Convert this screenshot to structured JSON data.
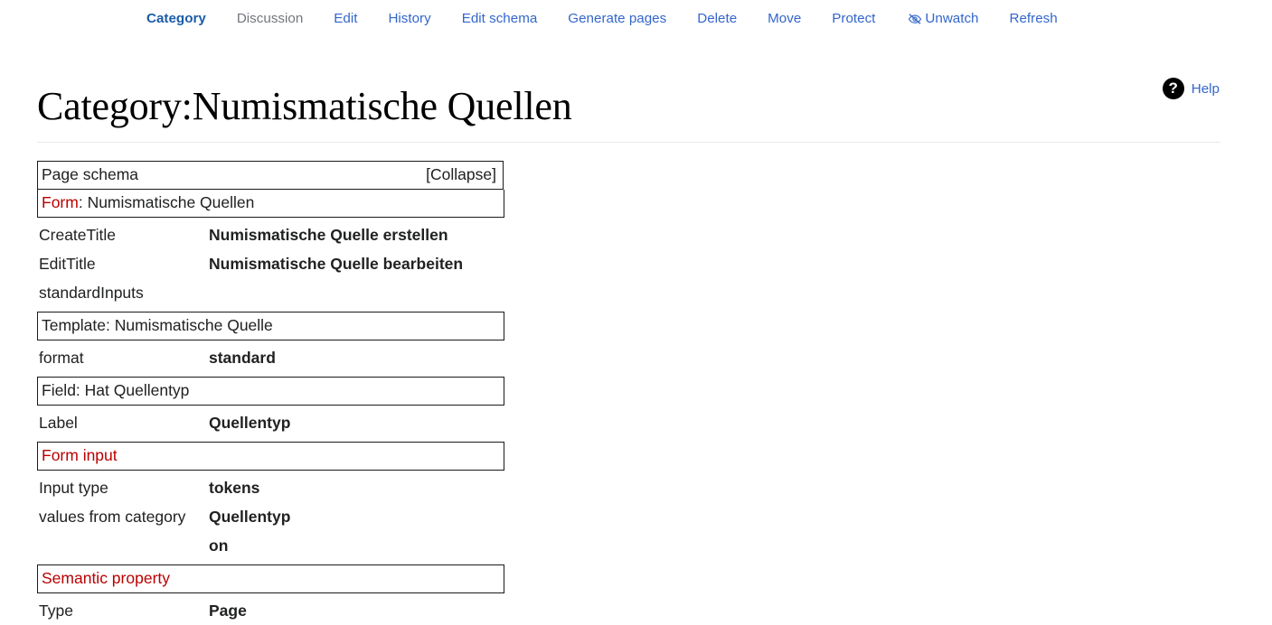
{
  "tabs": [
    {
      "label": "Category",
      "state": "selected",
      "icon": null
    },
    {
      "label": "Discussion",
      "state": "new",
      "icon": null
    },
    {
      "label": "Edit",
      "state": "link",
      "icon": null
    },
    {
      "label": "History",
      "state": "link",
      "icon": null
    },
    {
      "label": "Edit schema",
      "state": "link",
      "icon": null
    },
    {
      "label": "Generate pages",
      "state": "link",
      "icon": null
    },
    {
      "label": "Delete",
      "state": "link",
      "icon": null
    },
    {
      "label": "Move",
      "state": "link",
      "icon": null
    },
    {
      "label": "Protect",
      "state": "link",
      "icon": null
    },
    {
      "label": "Unwatch",
      "state": "link",
      "icon": "eye-slash-icon"
    },
    {
      "label": "Refresh",
      "state": "link",
      "icon": null
    }
  ],
  "help": {
    "icon": "question-mark-circle-icon",
    "icon_glyph": "?",
    "label": "Help"
  },
  "page_title": "Category:Numismatische Quellen",
  "schema": {
    "header": {
      "title": "Page schema",
      "collapse_label": "[Collapse]"
    },
    "form": {
      "link_label": "Form",
      "separator": ": ",
      "name": "Numismatische Quellen",
      "rows": [
        {
          "key": "CreateTitle",
          "value": "Numismatische Quelle erstellen"
        },
        {
          "key": "EditTitle",
          "value": "Numismatische Quelle bearbeiten"
        },
        {
          "key": "standardInputs",
          "value": ""
        }
      ]
    },
    "template": {
      "box_label": "Template: Numismatische Quelle",
      "rows": [
        {
          "key": "format",
          "value": "standard"
        }
      ]
    },
    "field": {
      "box_label": "Field: Hat Quellentyp",
      "rows": [
        {
          "key": "Label",
          "value": "Quellentyp"
        }
      ]
    },
    "form_input": {
      "box_label": "Form input",
      "rows": [
        {
          "key": "Input type",
          "value": "tokens"
        },
        {
          "key": "values from category",
          "value": "Quellentyp"
        },
        {
          "key": "",
          "value": "on"
        }
      ]
    },
    "semantic_property": {
      "box_label": "Semantic property",
      "rows": [
        {
          "key": "Type",
          "value": "Page"
        }
      ]
    }
  },
  "colors": {
    "link": "#3366cc",
    "link_selected": "#1b5ca8",
    "link_new": "#72777d",
    "redlink": "#ba0000",
    "text": "#202122",
    "rule": "#e8e8e8",
    "box_border": "#1a1a1a"
  }
}
